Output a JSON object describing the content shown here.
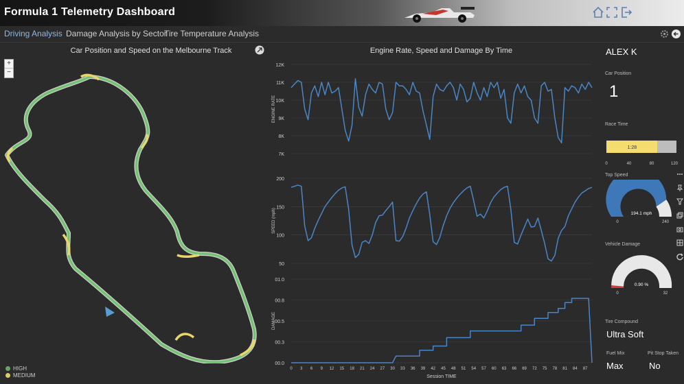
{
  "header": {
    "title": "Formula 1 Telemetry Dashboard"
  },
  "tabs": [
    {
      "label": "Driving Analysis",
      "active": true
    },
    {
      "label": "Damage Analysis by Sector",
      "active": false
    },
    {
      "label": "Tire Temperature Analysis",
      "active": false
    }
  ],
  "map": {
    "title": "Car Position and Speed on the Melbourne Track",
    "zoom_in": "+",
    "zoom_out": "−",
    "legend": [
      {
        "label": "HIGH",
        "color": "#6aa36a"
      },
      {
        "label": "MEDIUM",
        "color": "#d6cf6a"
      }
    ],
    "colors": {
      "high": "#72c26f",
      "medium": "#e8d66b",
      "track_outline": "#cfcfcf",
      "car_marker": "#5b9bd5"
    }
  },
  "charts": {
    "title": "Engine Rate, Speed and Damage By Time",
    "xlabel": "Session TIME"
  },
  "chart_data": [
    {
      "type": "line",
      "ylabel": "ENGINE RATE",
      "ylim": [
        7000,
        12000
      ],
      "yticks": [
        "12K",
        "11K",
        "10K",
        "9K",
        "8K",
        "7K"
      ],
      "grid": true,
      "x": [
        0,
        1,
        2,
        3,
        4,
        5,
        6,
        7,
        8,
        9,
        10,
        11,
        12,
        13,
        14,
        15,
        16,
        17,
        18,
        19,
        20,
        21,
        22,
        23,
        24,
        25,
        26,
        27,
        28,
        29,
        30,
        31,
        32,
        33,
        34,
        35,
        36,
        37,
        38,
        39,
        40,
        41,
        42,
        43,
        44,
        45,
        46,
        47,
        48,
        49,
        50,
        51,
        52,
        53,
        54,
        55,
        56,
        57,
        58,
        59,
        60,
        61,
        62,
        63,
        64,
        65,
        66,
        67,
        68,
        69,
        70,
        71,
        72,
        73,
        74,
        75,
        76,
        77,
        78,
        79,
        80,
        81,
        82,
        83,
        84,
        85,
        86,
        87,
        88,
        89
      ],
      "values": [
        10700,
        10900,
        11100,
        11000,
        9500,
        8900,
        10400,
        10800,
        10200,
        11000,
        10300,
        11000,
        10400,
        10500,
        10700,
        9500,
        8300,
        7700,
        8600,
        11200,
        9600,
        9100,
        10300,
        10900,
        10600,
        10400,
        11000,
        10900,
        9500,
        8900,
        9300,
        11000,
        10800,
        10800,
        10600,
        10300,
        11000,
        10500,
        10400,
        9400,
        8600,
        7800,
        10200,
        10900,
        10600,
        10500,
        10800,
        11000,
        10700,
        10000,
        10900,
        10600,
        9900,
        10100,
        11000,
        10400,
        10000,
        10700,
        10200,
        11000,
        10700,
        11000,
        10100,
        10600,
        9000,
        8700,
        10400,
        10900,
        10400,
        10800,
        10200,
        10000,
        9000,
        8700,
        10800,
        11000,
        10500,
        10600,
        9000,
        7900,
        7600,
        10700,
        10500,
        10800,
        10700,
        10400,
        10900,
        10600,
        11000,
        10700
      ],
      "xticks": [
        0,
        3,
        6,
        9,
        12,
        15,
        18,
        21,
        24,
        27,
        30,
        33,
        36,
        39,
        42,
        45,
        48,
        51,
        54,
        57,
        60,
        63,
        66,
        69,
        72,
        75,
        78,
        81,
        84,
        87
      ]
    },
    {
      "type": "line",
      "ylabel": "SPEED (mph)",
      "ylim": [
        50,
        200
      ],
      "yticks": [
        "200",
        "150",
        "100",
        "50"
      ],
      "grid": true,
      "values": [
        184,
        186,
        188,
        186,
        116,
        90,
        95,
        112,
        126,
        138,
        150,
        158,
        166,
        173,
        179,
        183,
        185,
        145,
        82,
        60,
        66,
        87,
        90,
        85,
        100,
        122,
        134,
        135,
        143,
        150,
        158,
        90,
        89,
        97,
        112,
        130,
        143,
        155,
        165,
        172,
        176,
        136,
        88,
        83,
        96,
        117,
        134,
        147,
        157,
        165,
        172,
        178,
        183,
        186,
        160,
        133,
        137,
        130,
        142,
        157,
        167,
        174,
        180,
        184,
        186,
        145,
        87,
        84,
        100,
        114,
        128,
        114,
        115,
        130,
        108,
        85,
        58,
        54,
        64,
        94,
        108,
        115,
        134,
        146,
        158,
        167,
        174,
        178,
        182,
        184
      ],
      "xticks": [
        0,
        3,
        6,
        9,
        12,
        15,
        18,
        21,
        24,
        27,
        30,
        33,
        36,
        39,
        42,
        45,
        48,
        51,
        54,
        57,
        60,
        63,
        66,
        69,
        72,
        75,
        78,
        81,
        84,
        87
      ]
    },
    {
      "type": "line",
      "ylabel": "DAMAGE",
      "ylim": [
        0.0,
        1.0
      ],
      "yticks": [
        "01.0",
        "00.8",
        "00.5",
        "00.3",
        "00.0"
      ],
      "grid": true,
      "step_points": [
        [
          0,
          0.0
        ],
        [
          30,
          0.0
        ],
        [
          31,
          0.08
        ],
        [
          38,
          0.08
        ],
        [
          38,
          0.15
        ],
        [
          42,
          0.15
        ],
        [
          42,
          0.2
        ],
        [
          46,
          0.2
        ],
        [
          46,
          0.3
        ],
        [
          53,
          0.3
        ],
        [
          53,
          0.38
        ],
        [
          68,
          0.38
        ],
        [
          68,
          0.45
        ],
        [
          72,
          0.45
        ],
        [
          72,
          0.53
        ],
        [
          76,
          0.53
        ],
        [
          76,
          0.6
        ],
        [
          79,
          0.6
        ],
        [
          79,
          0.65
        ],
        [
          81,
          0.65
        ],
        [
          81,
          0.72
        ],
        [
          83,
          0.72
        ],
        [
          83,
          0.77
        ],
        [
          88,
          0.77
        ],
        [
          89,
          0.0
        ]
      ],
      "xticks": [
        0,
        3,
        6,
        9,
        12,
        15,
        18,
        21,
        24,
        27,
        30,
        33,
        36,
        39,
        42,
        45,
        48,
        51,
        54,
        57,
        60,
        63,
        66,
        69,
        72,
        75,
        78,
        81,
        84,
        87
      ]
    }
  ],
  "driver": {
    "name": "ALEX K",
    "car_position_label": "Car Position",
    "car_position": "1",
    "race_time_label": "Race Time",
    "race_time_value": "1:28",
    "race_time_fraction": 0.733,
    "race_time_ticks": [
      "0",
      "40",
      "80",
      "120"
    ],
    "top_speed_label": "Top Speed",
    "top_speed_value": "194.1 mph",
    "top_speed_fraction": 0.809,
    "top_speed_min": "0",
    "top_speed_max": "240",
    "damage_label": "Vehicle Damage",
    "damage_value": "0.90 %",
    "damage_fraction": 0.028,
    "damage_min": "0",
    "damage_max": "32",
    "tire_label": "Tire Compound",
    "tire_value": "Ultra Soft",
    "fuel_label": "Fuel Mix",
    "fuel_value": "Max",
    "pit_label": "Pit Stop Taken",
    "pit_value": "No",
    "colors": {
      "bar_fill": "#f5dc6e",
      "bar_rest": "#bdbdbd",
      "gauge_fill": "#3f78b8",
      "gauge_rest": "#e8e8e8",
      "damage_fill": "#d9363e"
    }
  }
}
